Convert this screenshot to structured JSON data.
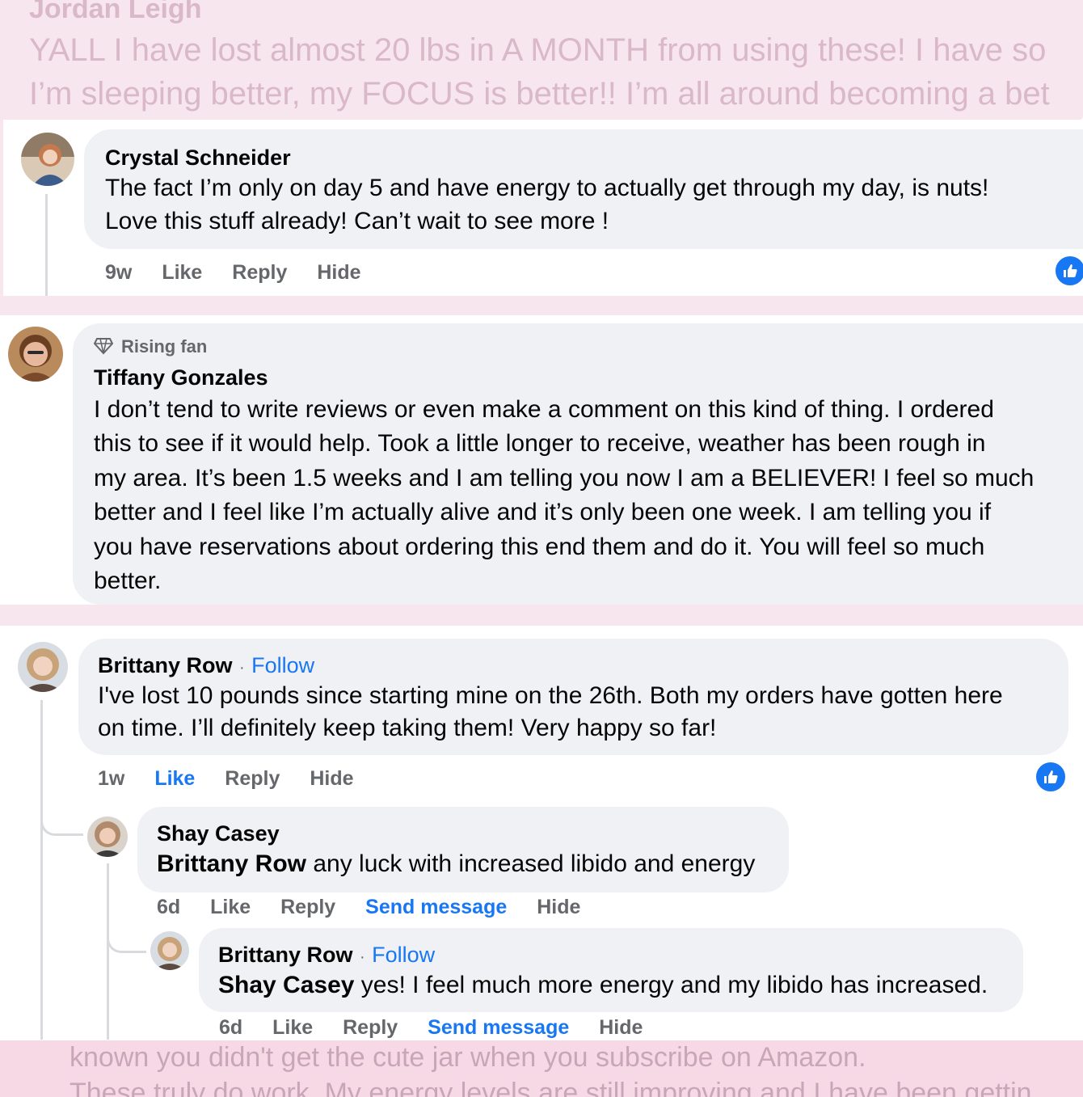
{
  "top_faded": {
    "name": "Jordan Leigh",
    "line1": "YALL I have lost almost 20 lbs in A MONTH from using these! I have so",
    "line2": "I’m sleeping better, my FOCUS is better!! I’m all around becoming a bet"
  },
  "comments": {
    "crystal": {
      "name": "Crystal Schneider",
      "line1": "The fact I’m only on day 5 and have energy to actually get through my day, is nuts!",
      "line2": "Love this stuff already! Can’t wait to see more !",
      "time": "9w",
      "like": "Like",
      "reply": "Reply",
      "hide": "Hide"
    },
    "tiffany": {
      "badge": "Rising fan",
      "name": "Tiffany Gonzales",
      "lines": [
        "I don’t tend to write reviews or even make a comment on this kind of thing. I ordered",
        "this to see if it would help. Took a little longer to receive, weather has been rough in",
        "my area. It’s been 1.5 weeks and I am telling you now I am a BELIEVER! I feel so much",
        "better and I feel like I’m actually alive and it’s only been one week. I am telling you if",
        "you have reservations about ordering this end them and do it. You will feel so much",
        "better."
      ]
    },
    "brittany": {
      "name": "Brittany Row",
      "separator": "·",
      "follow": "Follow",
      "line1": "I've lost 10 pounds since starting mine on the 26th. Both my orders have gotten here",
      "line2": "on time. I’ll definitely keep taking them! Very happy so far!",
      "time": "1w",
      "like": "Like",
      "reply": "Reply",
      "hide": "Hide"
    },
    "shay": {
      "name": "Shay Casey",
      "mention": "Brittany Row",
      "text": " any luck with increased libido and energy",
      "time": "6d",
      "like": "Like",
      "reply": "Reply",
      "send": "Send message",
      "hide": "Hide"
    },
    "brittany_reply": {
      "name": "Brittany Row",
      "separator": "·",
      "follow": "Follow",
      "mention": "Shay Casey",
      "text": " yes! I feel much more energy and my libido has increased.",
      "time": "6d",
      "like": "Like",
      "reply": "Reply",
      "send": "Send message",
      "hide": "Hide"
    }
  },
  "bottom_faded": {
    "line1": "known you didn't get the cute jar when you subscribe on Amazon.",
    "line2": "These truly do work. My energy levels are still improving and I have been gettin"
  },
  "colors": {
    "accent": "#1877f2",
    "bubble": "#f0f1f5",
    "band": "#f8e6ef"
  }
}
